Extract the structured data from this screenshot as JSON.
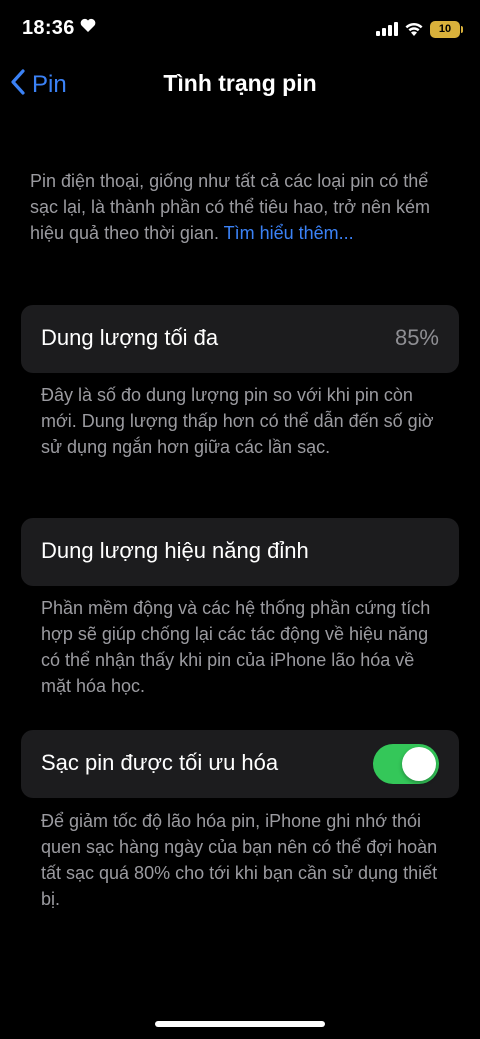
{
  "status_bar": {
    "time": "18:36",
    "battery": "10"
  },
  "nav": {
    "back_label": "Pin",
    "title": "Tình trạng pin"
  },
  "intro": {
    "text": "Pin điện thoại, giống như tất cả các loại pin có thể sạc lại, là thành phần có thể tiêu hao, trở nên kém hiệu quả theo thời gian. ",
    "link": "Tìm hiểu thêm..."
  },
  "max_capacity": {
    "label": "Dung lượng tối đa",
    "value": "85%",
    "footnote": "Đây là số đo dung lượng pin so với khi pin còn mới. Dung lượng thấp hơn có thể dẫn đến số giờ sử dụng ngắn hơn giữa các lần sạc."
  },
  "peak_performance": {
    "label": "Dung lượng hiệu năng đỉnh",
    "footnote": "Phần mềm động và các hệ thống phần cứng tích hợp sẽ giúp chống lại các tác động về hiệu năng có thể nhận thấy khi pin của iPhone lão hóa về mặt hóa học."
  },
  "optimized_charging": {
    "label": "Sạc pin được tối ưu hóa",
    "enabled": true,
    "footnote": "Để giảm tốc độ lão hóa pin, iPhone ghi nhớ thói quen sạc hàng ngày của bạn nên có thể đợi hoàn tất sạc quá 80% cho tới khi bạn cần sử dụng thiết bị."
  },
  "colors": {
    "accent": "#3b82f6",
    "toggle_on": "#34c759",
    "card_bg": "#1c1c1e",
    "battery_low": "#d9b13b"
  },
  "icons": [
    "heart-icon",
    "cellular-signal-icon",
    "wifi-icon",
    "battery-icon",
    "chevron-left-icon"
  ]
}
